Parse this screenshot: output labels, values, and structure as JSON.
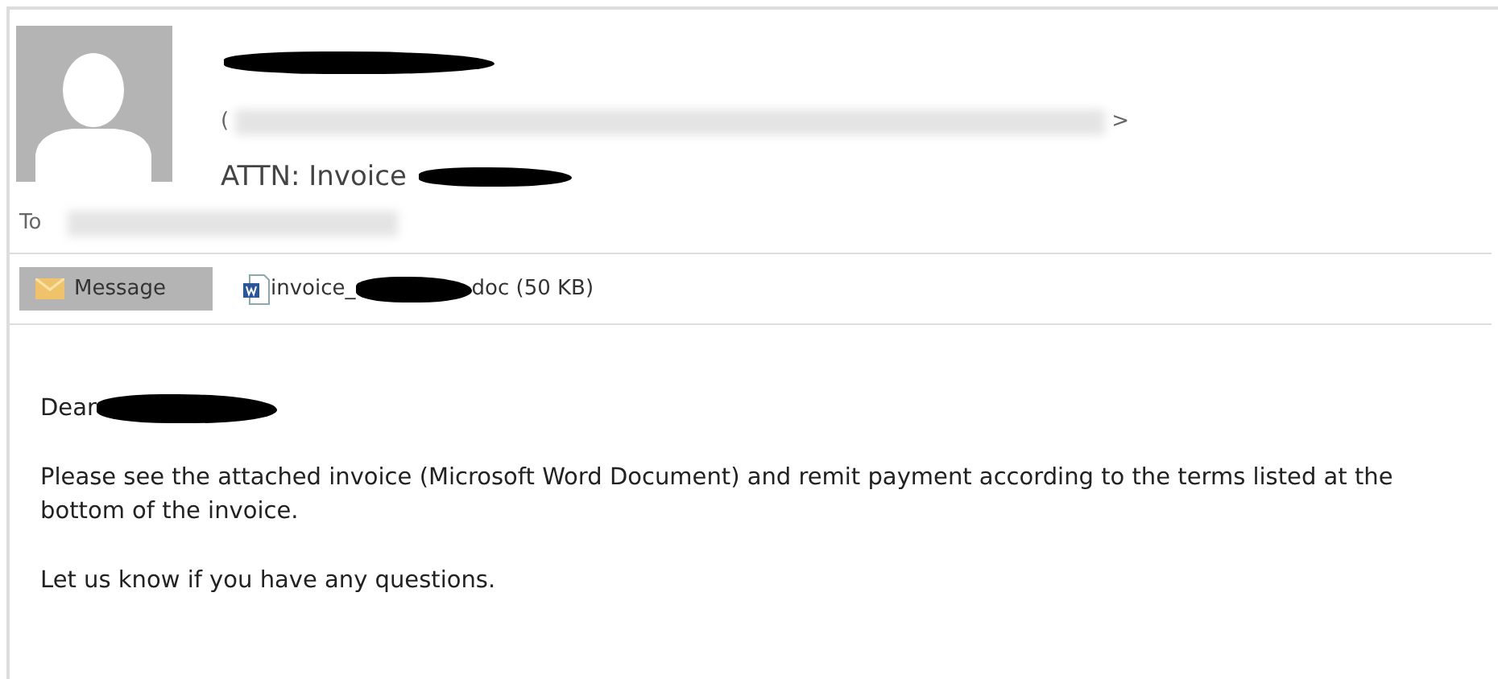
{
  "header": {
    "sender_open": "(",
    "sender_close": ">",
    "subject": "ATTN: Invoice",
    "to_label": "To"
  },
  "tabs": [
    {
      "label": "Message",
      "kind": "message",
      "selected": true
    },
    {
      "label_start": "invoice_",
      "label_end": "doc (50 KB)",
      "kind": "attachment",
      "selected": false
    }
  ],
  "body": {
    "greeting": "Dear",
    "paragraphs": [
      "Please see the attached invoice (Microsoft Word Document) and remit payment according to the terms listed at the bottom of the invoice.",
      "Let us know if you have any questions."
    ]
  }
}
